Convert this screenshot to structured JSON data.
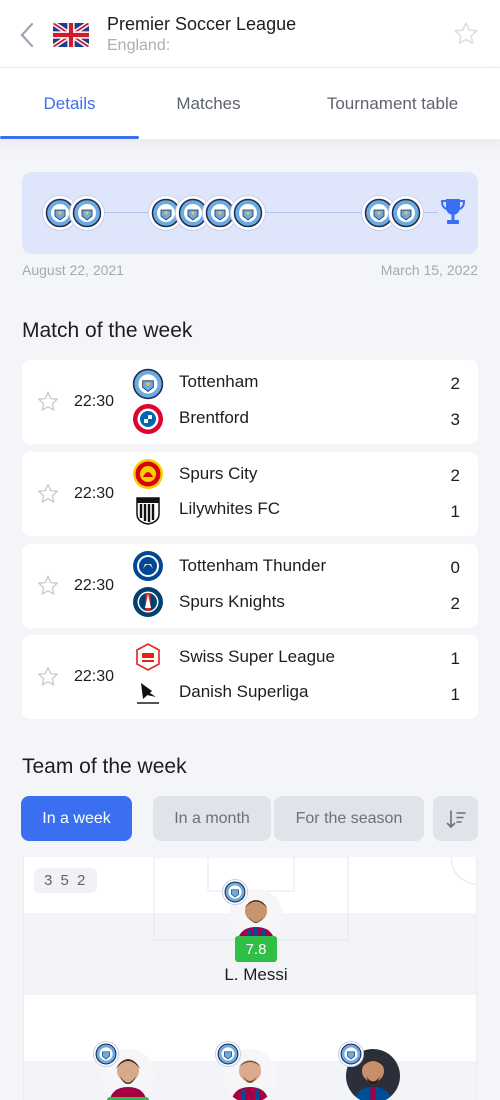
{
  "header": {
    "title": "Premier Soccer League",
    "subtitle": "England:",
    "icons": {
      "back": "chevron-left-icon",
      "flag": "uk-flag-icon",
      "favorite": "star-outline-icon"
    }
  },
  "tabs": [
    {
      "label": "Details",
      "active": true
    },
    {
      "label": "Matches",
      "active": false
    },
    {
      "label": "Tournament table",
      "active": false
    }
  ],
  "timeline": {
    "start_date": "August 22, 2021",
    "end_date": "March 15, 2022",
    "icon": "trophy-icon"
  },
  "match_of_week": {
    "title": "Match of the week",
    "matches": [
      {
        "time": "22:30",
        "home": "Tottenham",
        "away": "Brentford",
        "home_score": "2",
        "away_score": "3"
      },
      {
        "time": "22:30",
        "home": "Spurs City",
        "away": "Lilywhites FC",
        "home_score": "2",
        "away_score": "1"
      },
      {
        "time": "22:30",
        "home": "Tottenham Thunder",
        "away": "Spurs Knights",
        "home_score": "0",
        "away_score": "2"
      },
      {
        "time": "22:30",
        "home": "Swiss Super League",
        "away": "Danish Superliga",
        "home_score": "1",
        "away_score": "1"
      }
    ]
  },
  "team_of_week": {
    "title": "Team of the week",
    "filters": [
      "In a week",
      "In a month",
      "For the season"
    ],
    "active_filter": "In a week",
    "formation": "3 5 2",
    "featured_player": {
      "name": "L. Messi",
      "rating": "7.8"
    }
  },
  "colors": {
    "accent": "#3a6ff2",
    "rating": "#2fbf47",
    "background": "#f4f5f9"
  }
}
